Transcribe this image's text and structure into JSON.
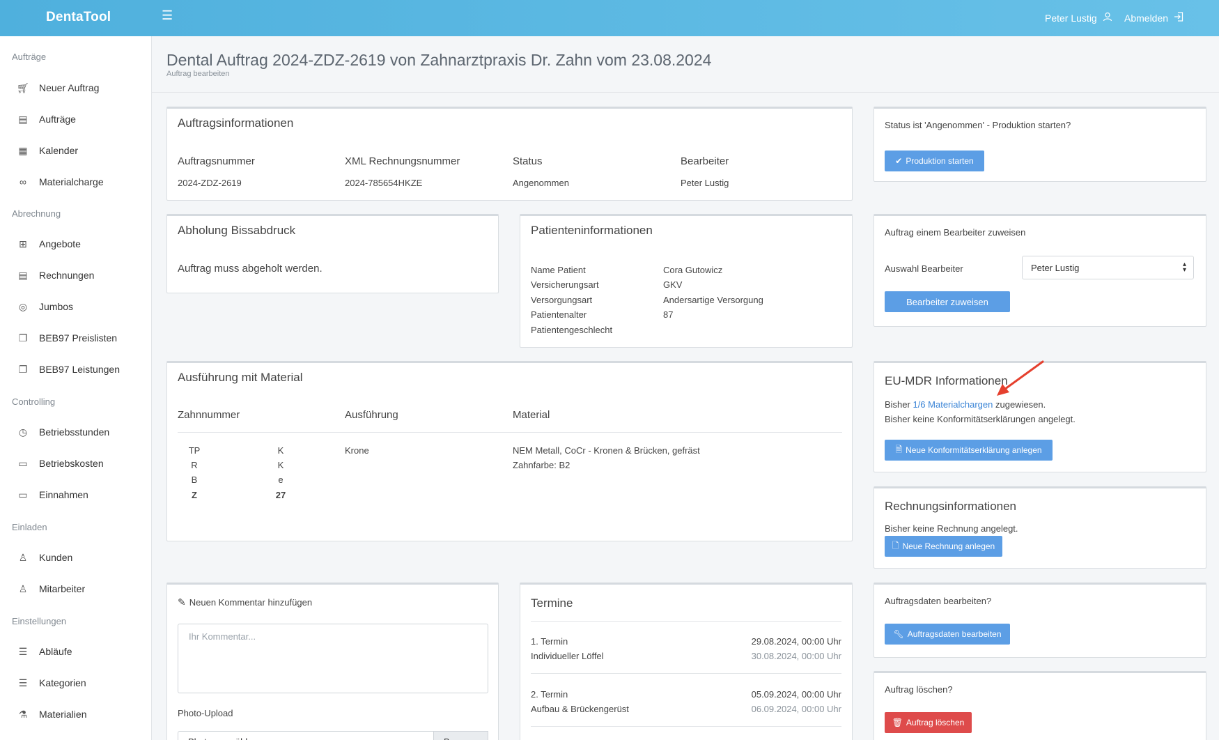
{
  "topbar": {
    "brand": "DentaTool",
    "menu_icon": "hamburger-menu-icon",
    "user_name": "Peter Lustig",
    "logout_label": "Abmelden"
  },
  "sidebar": {
    "sections": [
      {
        "title": "Aufträge",
        "items": [
          {
            "label": "Neuer Auftrag",
            "icon": "cart-icon"
          },
          {
            "label": "Aufträge",
            "icon": "book-icon"
          },
          {
            "label": "Kalender",
            "icon": "calendar-icon"
          },
          {
            "label": "Materialcharge",
            "icon": "link-icon"
          }
        ]
      },
      {
        "title": "Abrechnung",
        "items": [
          {
            "label": "Angebote",
            "icon": "calculator-icon"
          },
          {
            "label": "Rechnungen",
            "icon": "book-icon"
          },
          {
            "label": "Jumbos",
            "icon": "support-icon"
          },
          {
            "label": "BEB97 Preislisten",
            "icon": "files-icon"
          },
          {
            "label": "BEB97 Leistungen",
            "icon": "files-icon"
          }
        ]
      },
      {
        "title": "Controlling",
        "items": [
          {
            "label": "Betriebsstunden",
            "icon": "clock-icon"
          },
          {
            "label": "Betriebskosten",
            "icon": "folder-icon"
          },
          {
            "label": "Einnahmen",
            "icon": "folder-icon"
          }
        ]
      },
      {
        "title": "Einladen",
        "items": [
          {
            "label": "Kunden",
            "icon": "user-icon"
          },
          {
            "label": "Mitarbeiter",
            "icon": "user-icon"
          }
        ]
      },
      {
        "title": "Einstellungen",
        "items": [
          {
            "label": "Abläufe",
            "icon": "list-icon"
          },
          {
            "label": "Kategorien",
            "icon": "list-icon"
          },
          {
            "label": "Materialien",
            "icon": "beaker-icon"
          }
        ]
      }
    ]
  },
  "page": {
    "title": "Dental Auftrag 2024-ZDZ-2619 von Zahnarztpraxis Dr. Zahn vom 23.08.2024",
    "subtitle": "Auftrag bearbeiten"
  },
  "auftragsinfo": {
    "title": "Auftragsinformationen",
    "headers": [
      "Auftragsnummer",
      "XML Rechnungsnummer",
      "Status",
      "Bearbeiter"
    ],
    "values": [
      "2024-ZDZ-2619",
      "2024-785654HKZE",
      "Angenommen",
      "Peter Lustig"
    ]
  },
  "abholung": {
    "title": "Abholung Bissabdruck",
    "text": "Auftrag muss abgeholt werden."
  },
  "patient": {
    "title": "Patienteninformationen",
    "rows": [
      {
        "label": "Name Patient",
        "value": "Cora Gutowicz"
      },
      {
        "label": "Versicherungsart",
        "value": "GKV"
      },
      {
        "label": "Versorgungsart",
        "value": "Andersartige Versorgung"
      },
      {
        "label": "Patientenalter",
        "value": "87"
      },
      {
        "label": "Patientengeschlecht",
        "value": ""
      }
    ]
  },
  "ausfuehrung": {
    "title": "Ausführung mit Material",
    "headers": [
      "Zahnnummer",
      "Ausführung",
      "Material"
    ],
    "tooth_letters": [
      "TP",
      "R",
      "B",
      "Z"
    ],
    "tooth_values": [
      "K",
      "K",
      "e",
      "27"
    ],
    "execution": "Krone",
    "material_lines": [
      "NEM Metall, CoCr - Kronen & Brücken, gefräst",
      "Zahnfarbe: B2"
    ]
  },
  "comment": {
    "title": "Neuen Kommentar hinzufügen",
    "placeholder": "Ihr Kommentar...",
    "photo_label": "Photo-Upload",
    "file_placeholder": "Photo auswählen...",
    "browse_label": "Browse"
  },
  "termine": {
    "title": "Termine",
    "items": [
      {
        "label": "1. Termin",
        "name": "Individueller Löffel",
        "date1": "29.08.2024, 00:00 Uhr",
        "date2": "30.08.2024, 00:00 Uhr"
      },
      {
        "label": "2. Termin",
        "name": "Aufbau & Brückengerüst",
        "date1": "05.09.2024, 00:00 Uhr",
        "date2": "06.09.2024, 00:00 Uhr"
      }
    ]
  },
  "status_card": {
    "text": "Status ist 'Angenommen' - Produktion starten?",
    "button": "Produktion starten"
  },
  "assign_card": {
    "title": "Auftrag einem Bearbeiter zuweisen",
    "label": "Auswahl Bearbeiter",
    "selected": "Peter Lustig",
    "button": "Bearbeiter zuweisen"
  },
  "mdr_card": {
    "title": "EU-MDR Informationen",
    "line1_pre": "Bisher ",
    "line1_link": "1/6 Materialchargen",
    "line1_post": " zugewiesen.",
    "line2": "Bisher keine Konformitätserklärungen angelegt.",
    "button": "Neue Konformitätserklärung anlegen"
  },
  "invoice_card": {
    "title": "Rechnungsinformationen",
    "text": "Bisher keine Rechnung angelegt.",
    "button": "Neue Rechnung anlegen"
  },
  "edit_card": {
    "text": "Auftragsdaten bearbeiten?",
    "button": "Auftragsdaten bearbeiten"
  },
  "delete_card": {
    "text": "Auftrag löschen?",
    "button": "Auftrag löschen"
  },
  "colors": {
    "topbar": "#5bb8e3",
    "primary_button": "#5c9ee5",
    "danger_button": "#de4b4b",
    "link": "#3a84d6",
    "annotation_arrow": "#e5402e"
  }
}
